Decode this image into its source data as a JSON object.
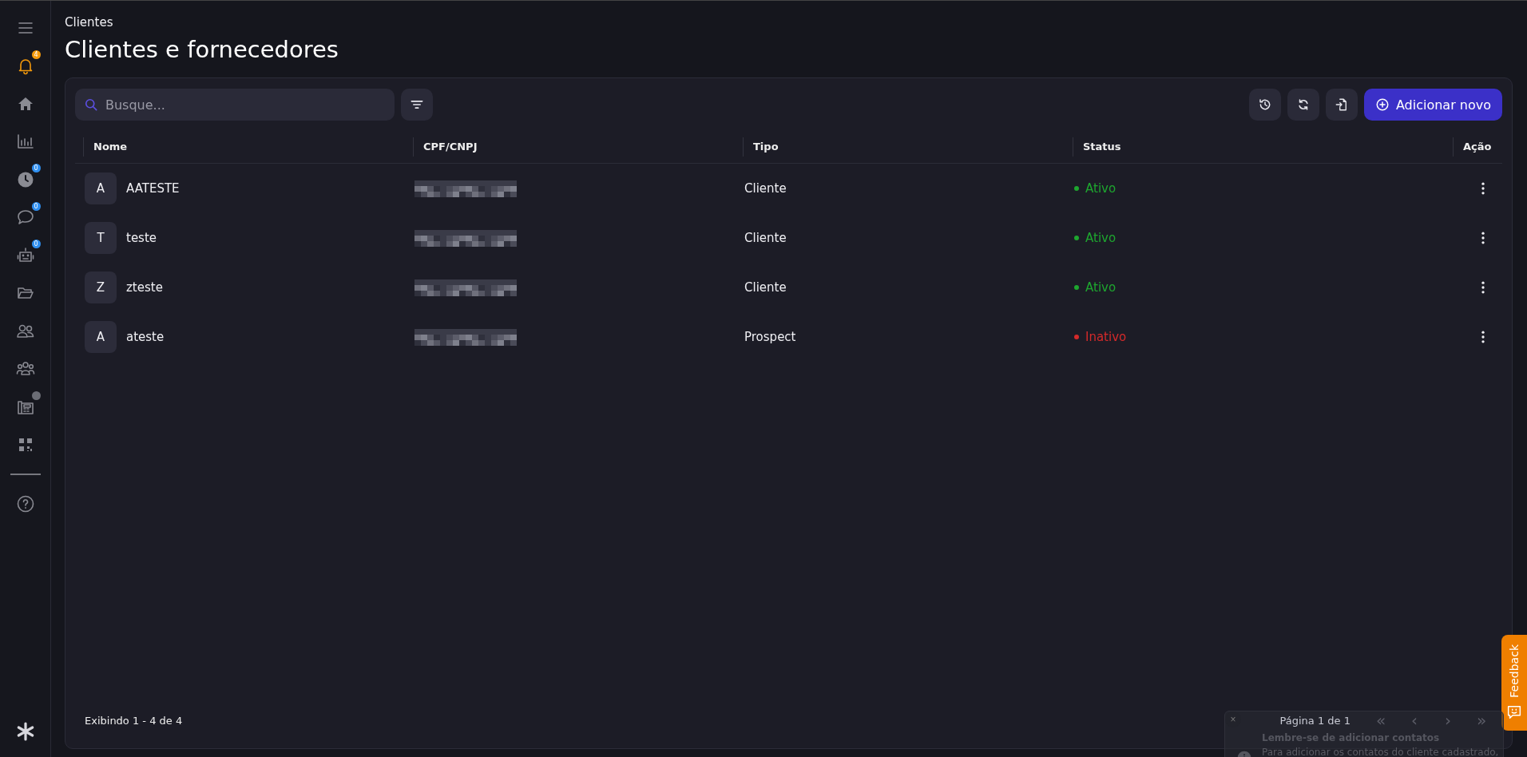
{
  "sidebar": {
    "items": [
      {
        "kind": "menu",
        "highlighted": false
      },
      {
        "kind": "bell",
        "highlighted": true,
        "badge": {
          "text": "4",
          "color": "#f59a0b"
        }
      },
      {
        "kind": "home",
        "highlighted": false
      },
      {
        "kind": "chart",
        "highlighted": false
      },
      {
        "kind": "clock",
        "highlighted": false,
        "badge": {
          "text": "0",
          "color": "#2f8ff0"
        }
      },
      {
        "kind": "chat",
        "highlighted": false,
        "badge": {
          "text": "0",
          "color": "#2f8ff0"
        }
      },
      {
        "kind": "robot",
        "highlighted": false,
        "badge": {
          "text": "0",
          "color": "#2f8ff0"
        }
      },
      {
        "kind": "folder",
        "highlighted": false
      },
      {
        "kind": "users",
        "highlighted": false
      },
      {
        "kind": "group",
        "highlighted": false
      },
      {
        "kind": "phone",
        "highlighted": false,
        "badge": {
          "color": "#6b6d75"
        }
      },
      {
        "kind": "qr",
        "highlighted": false
      },
      {
        "kind": "divider"
      },
      {
        "kind": "help",
        "highlighted": false
      }
    ],
    "bottom": {
      "kind": "asterisk"
    }
  },
  "breadcrumb": "Clientes",
  "title": "Clientes e fornecedores",
  "search": {
    "placeholder": "Busque..."
  },
  "toolbar": {
    "buttons": [
      {
        "kind": "history"
      },
      {
        "kind": "refresh"
      },
      {
        "kind": "import"
      }
    ],
    "add_button": "Adicionar novo"
  },
  "table": {
    "columns": [
      "Nome",
      "CPF/CNPJ",
      "Tipo",
      "Status",
      "Ação"
    ],
    "rows": [
      {
        "initial": "A",
        "name": "AATESTE",
        "cpf_redacted": true,
        "type": "Cliente",
        "status": {
          "label": "Ativo",
          "color": "#1ea62f"
        }
      },
      {
        "initial": "T",
        "name": "teste",
        "cpf_redacted": true,
        "type": "Cliente",
        "status": {
          "label": "Ativo",
          "color": "#1ea62f"
        }
      },
      {
        "initial": "Z",
        "name": "zteste",
        "cpf_redacted": true,
        "type": "Cliente",
        "status": {
          "label": "Ativo",
          "color": "#1ea62f"
        }
      },
      {
        "initial": "A",
        "name": "ateste",
        "cpf_redacted": true,
        "type": "Prospect",
        "status": {
          "label": "Inativo",
          "color": "#d42a2a"
        }
      }
    ]
  },
  "footer": {
    "showing": "Exibindo 1 - 4 de 4",
    "page": "Página 1 de 1",
    "first": "«",
    "prev": "‹",
    "next": "›",
    "last": "»"
  },
  "toast": {
    "close": "×",
    "title": "Lembre-se de adicionar contatos",
    "message": "Para adicionar os contatos do cliente cadastrado,"
  },
  "feedback_tab": {
    "label": "Feedback"
  }
}
